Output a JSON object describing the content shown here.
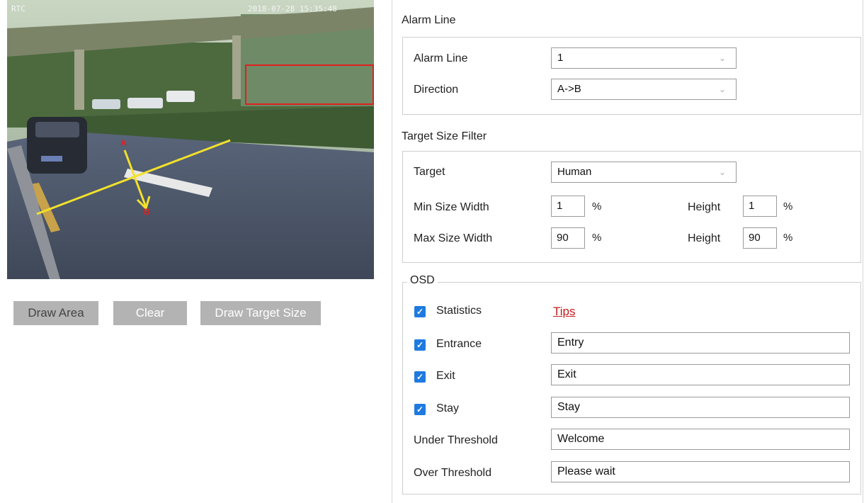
{
  "preview": {
    "corner_text": "RTC",
    "timestamp_text": "2018-07-28 15:35:48",
    "line_point_a": "A",
    "line_point_b": "B"
  },
  "buttons": {
    "draw_area": "Draw Area",
    "clear": "Clear",
    "draw_target_size": "Draw Target Size"
  },
  "alarm_line_section": {
    "title": "Alarm Line",
    "alarm_line_label": "Alarm Line",
    "alarm_line_value": "1",
    "direction_label": "Direction",
    "direction_value": "A->B"
  },
  "target_size_section": {
    "title": "Target Size Filter",
    "target_label": "Target",
    "target_value": "Human",
    "min_width_label": "Min Size Width",
    "min_width_value": "1",
    "min_height_label": "Height",
    "min_height_value": "1",
    "max_width_label": "Max Size Width",
    "max_width_value": "90",
    "max_height_label": "Height",
    "max_height_value": "90",
    "percent": "%"
  },
  "osd_section": {
    "title": "OSD",
    "statistics_label": "Statistics",
    "tips_link": "Tips",
    "entrance_label": "Entrance",
    "entrance_value": "Entry",
    "exit_label": "Exit",
    "exit_value": "Exit",
    "stay_label": "Stay",
    "stay_value": "Stay",
    "under_threshold_label": "Under Threshold",
    "under_threshold_value": "Welcome",
    "over_threshold_label": "Over Threshold",
    "over_threshold_value": "Please wait",
    "checkbox_mark": "✓"
  },
  "colors": {
    "button_gray": "#b3b3b3",
    "checkbox_blue": "#1f7ae0",
    "tips_red": "#c21c1c",
    "alarm_line_yellow": "#f2e12b"
  }
}
